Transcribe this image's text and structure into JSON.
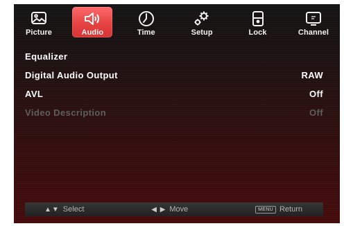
{
  "tabs": [
    {
      "label": "Picture",
      "icon": "picture-icon",
      "active": false
    },
    {
      "label": "Audio",
      "icon": "speaker-icon",
      "active": true
    },
    {
      "label": "Time",
      "icon": "clock-icon",
      "active": false
    },
    {
      "label": "Setup",
      "icon": "gears-icon",
      "active": false
    },
    {
      "label": "Lock",
      "icon": "lock-icon",
      "active": false
    },
    {
      "label": "Channel",
      "icon": "tv-screen-icon",
      "active": false
    }
  ],
  "menu": {
    "items": [
      {
        "label": "Equalizer",
        "value": "",
        "enabled": true
      },
      {
        "label": "Digital Audio Output",
        "value": "RAW",
        "enabled": true
      },
      {
        "label": "AVL",
        "value": "Off",
        "enabled": true
      },
      {
        "label": "Video Description",
        "value": "Off",
        "enabled": false
      }
    ]
  },
  "hints": {
    "select_glyph": "▲▼",
    "select_label": "Select",
    "move_glyph": "◀ ▶",
    "move_label": "Move",
    "return_key": "MENU",
    "return_label": "Return"
  },
  "colors": {
    "active_tab": "#e64343",
    "text": "#ffffff",
    "disabled_text": "#5e5e5e",
    "background_bottom": "#450b0b"
  }
}
